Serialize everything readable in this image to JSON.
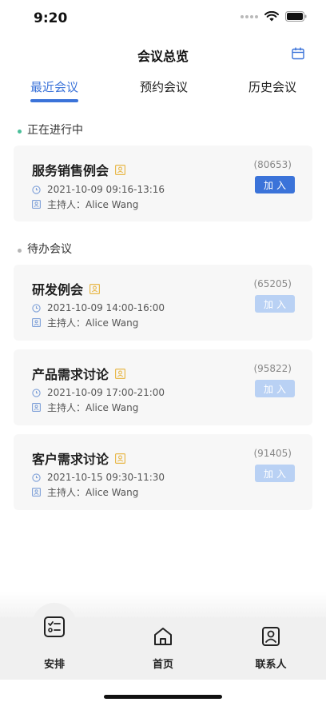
{
  "status_bar": {
    "time": "9:20"
  },
  "header": {
    "title": "会议总览",
    "calendar_icon": "calendar-icon"
  },
  "tabs": [
    {
      "label": "最近会议",
      "active": true
    },
    {
      "label": "预约会议",
      "active": false
    },
    {
      "label": "历史会议",
      "active": false
    }
  ],
  "sections": {
    "ongoing": {
      "label": "正在进行中",
      "dot_color": "#4bbf9a"
    },
    "pending": {
      "label": "待办会议",
      "dot_color": "#b5b5b5"
    }
  },
  "meetings": [
    {
      "title": "服务销售例会",
      "time": "2021-10-09 09:16-13:16",
      "host": "主持人：Alice Wang",
      "code": "(80653)",
      "join_label": "加入",
      "join_enabled": true
    },
    {
      "title": "研发例会",
      "time": "2021-10-09 14:00-16:00",
      "host": "主持人：Alice Wang",
      "code": "(65205)",
      "join_label": "加入",
      "join_enabled": false
    },
    {
      "title": "产品需求讨论",
      "time": "2021-10-09 17:00-21:00",
      "host": "主持人：Alice Wang",
      "code": "(95822)",
      "join_label": "加入",
      "join_enabled": false
    },
    {
      "title": "客户需求讨论",
      "time": "2021-10-15 09:30-11:30",
      "host": "主持人：Alice Wang",
      "code": "(91405)",
      "join_label": "加入",
      "join_enabled": false
    }
  ],
  "bottom_nav": [
    {
      "label": "安排",
      "icon": "checklist-icon"
    },
    {
      "label": "首页",
      "icon": "home-icon"
    },
    {
      "label": "联系人",
      "icon": "contact-icon"
    }
  ],
  "colors": {
    "accent": "#3b73d9",
    "disabled": "#b9d1f4",
    "badge": "#e8b84a",
    "icon_blue": "#7ea0d8"
  }
}
